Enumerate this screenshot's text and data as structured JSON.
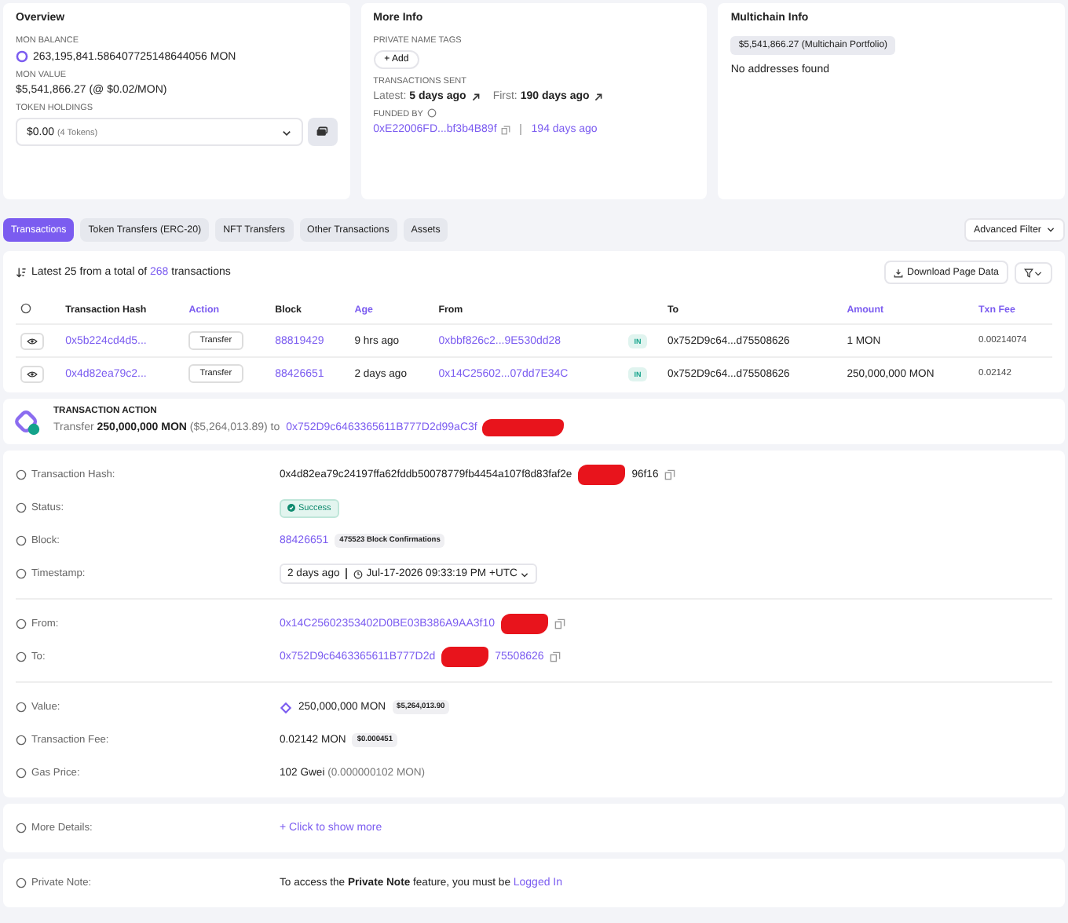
{
  "overview": {
    "title": "Overview",
    "balance_label": "MON BALANCE",
    "balance": "263,195,841.586407725148644056 MON",
    "value_label": "MON VALUE",
    "value": "$5,541,866.27 (@ $0.02/MON)",
    "holdings_label": "TOKEN HOLDINGS",
    "holdings_value": "$0.00",
    "holdings_count": "(4 Tokens)"
  },
  "more_info": {
    "title": "More Info",
    "tags_label": "PRIVATE NAME TAGS",
    "add_button": "+ Add",
    "sent_label": "TRANSACTIONS SENT",
    "latest_label": "Latest:",
    "latest": "5 days ago",
    "first_label": "First:",
    "first": "190 days ago",
    "funded_label": "FUNDED BY",
    "funded_address": "0xE22006FD...bf3b4B89f",
    "funded_age": "194 days ago"
  },
  "multichain": {
    "title": "Multichain Info",
    "portfolio": "$5,541,866.27 (Multichain Portfolio)",
    "empty": "No addresses found"
  },
  "tabs": [
    {
      "label": "Transactions",
      "selected": true
    },
    {
      "label": "Token Transfers (ERC-20)",
      "selected": false
    },
    {
      "label": "NFT Transfers",
      "selected": false
    },
    {
      "label": "Other Transactions",
      "selected": false
    },
    {
      "label": "Assets",
      "selected": false
    }
  ],
  "advanced_filter": "Advanced Filter",
  "summary": {
    "prefix": "Latest 25 from a total of",
    "count": "268",
    "suffix": "transactions"
  },
  "download_button": "Download Page Data",
  "table": {
    "columns": [
      {
        "label": "Transaction Hash",
        "link": false
      },
      {
        "label": "Action",
        "link": true
      },
      {
        "label": "Block",
        "link": false
      },
      {
        "label": "Age",
        "link": true
      },
      {
        "label": "From",
        "link": false
      },
      {
        "label": "To",
        "link": false
      },
      {
        "label": "Amount",
        "link": true
      },
      {
        "label": "Txn Fee",
        "link": true
      }
    ],
    "rows": [
      {
        "hash": "0x5b224cd4d5...",
        "action": "Transfer",
        "block": "88819429",
        "age": "9 hrs ago",
        "from": "0xbbf826c2...9E530dd28",
        "direction": "IN",
        "to": "0x752D9c64...d75508626",
        "amount": "1 MON",
        "fee": "0.00214074"
      },
      {
        "hash": "0x4d82ea79c2...",
        "action": "Transfer",
        "block": "88426651",
        "age": "2 days ago",
        "from": "0x14C25602...07dd7E34C",
        "direction": "IN",
        "to": "0x752D9c64...d75508626",
        "amount": "250,000,000 MON",
        "fee": "0.02142"
      }
    ]
  },
  "action": {
    "title": "TRANSACTION ACTION",
    "verb": "Transfer",
    "amount": "250,000,000 MON",
    "usd": "($5,264,013.89)",
    "to_word": "to",
    "address": "0x752D9c6463365611B777D2d99aC3f",
    "redacted": true
  },
  "details": [
    {
      "label": "Transaction Hash:",
      "kind": "hash",
      "value": "0x4d82ea79c24197ffa62fddb50078779fb4454a107f8d83faf2e",
      "tail": "96f16",
      "redacted": true
    },
    {
      "label": "Status:",
      "kind": "status",
      "value": "Success"
    },
    {
      "label": "Block:",
      "kind": "block",
      "value": "88426651",
      "badge": "475523 Block Confirmations"
    },
    {
      "label": "Timestamp:",
      "kind": "time",
      "age": "2 days ago",
      "value": "Jul-17-2026 09:33:19 PM +UTC"
    },
    {
      "label": "From:",
      "kind": "address",
      "value": "0x14C25602353402D0BE03B386A9AA3f10",
      "redacted": true,
      "divider": true
    },
    {
      "label": "To:",
      "kind": "address",
      "value": "0x752D9c6463365611B777D2d",
      "tail": "75508626",
      "redacted": true
    },
    {
      "label": "Value:",
      "kind": "value",
      "value": "250,000,000 MON",
      "badge": "$5,264,013.90",
      "divider": true
    },
    {
      "label": "Transaction Fee:",
      "kind": "fee",
      "value": "0.02142 MON",
      "badge": "$0.000451"
    },
    {
      "label": "Gas Price:",
      "kind": "gas",
      "value": "102 Gwei",
      "extra": "(0.000000102 MON)"
    }
  ],
  "more_details": {
    "label": "More Details:",
    "link": "+ Click to show more"
  },
  "private_note": {
    "label": "Private Note:",
    "text": "To access the **Private Note** feature, you must be",
    "link": "Logged In"
  }
}
